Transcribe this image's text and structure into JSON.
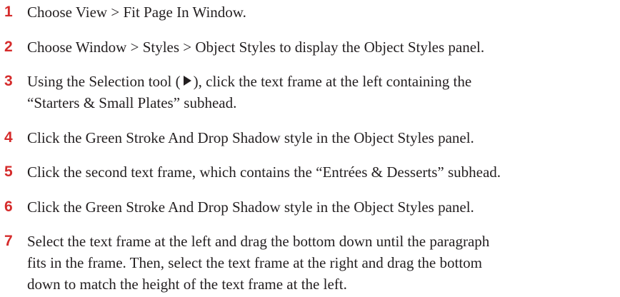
{
  "colors": {
    "number": "#d52b2b",
    "text": "#231f20"
  },
  "steps": [
    {
      "number": "1",
      "lines": [
        "Choose View > Fit Page In Window."
      ]
    },
    {
      "number": "2",
      "lines": [
        "Choose Window > Styles > Object Styles to display the Object Styles panel."
      ]
    },
    {
      "number": "3",
      "line1_before": "Using the Selection tool (",
      "line1_icon": "selection-tool-arrow-icon",
      "line1_after": "), click the text frame at the left containing the",
      "lines": [
        "“Starters & Small Plates” subhead."
      ]
    },
    {
      "number": "4",
      "lines": [
        "Click the Green Stroke And Drop Shadow style in the Object Styles panel."
      ]
    },
    {
      "number": "5",
      "lines": [
        "Click the second text frame, which contains the “Entrées & Desserts” subhead."
      ]
    },
    {
      "number": "6",
      "lines": [
        "Click the Green Stroke And Drop Shadow style in the Object Styles panel."
      ]
    },
    {
      "number": "7",
      "lines": [
        "Select the text frame at the left and drag the bottom down until the paragraph",
        "fits in the frame. Then, select the text frame at the right and drag the bottom",
        "down to match the height of the text frame at the left."
      ]
    }
  ]
}
